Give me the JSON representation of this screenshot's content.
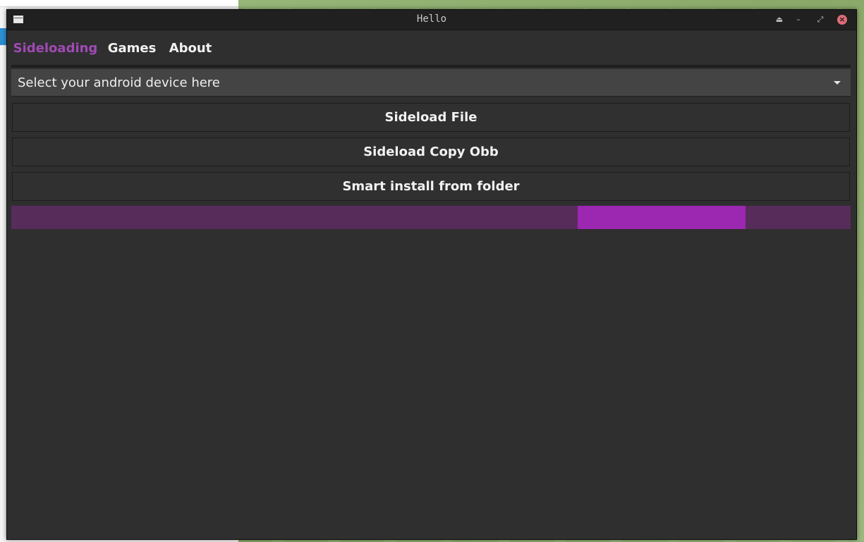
{
  "window": {
    "title": "Hello",
    "controls": {
      "keep_above_icon": "eject-icon",
      "minimize_icon": "minimize-icon",
      "maximize_icon": "maximize-icon",
      "close_icon": "close-icon"
    }
  },
  "tabs": [
    {
      "label": "Sideloading",
      "active": true
    },
    {
      "label": "Games",
      "active": false
    },
    {
      "label": "About",
      "active": false
    }
  ],
  "device_select": {
    "value": "Select your android device here",
    "icon": "chevron-down-icon"
  },
  "actions": {
    "sideload_file": "Sideload File",
    "sideload_copy_obb": "Sideload Copy Obb",
    "smart_install": "Smart install from folder"
  },
  "progress": {
    "mode": "indeterminate"
  },
  "colors": {
    "accent": "#9c27b0",
    "tab_active": "#a04ab4",
    "progress_track": "#572c5b",
    "window_bg": "#2f2f2f",
    "titlebar_bg": "#202020",
    "close_button": "#e06c75"
  }
}
